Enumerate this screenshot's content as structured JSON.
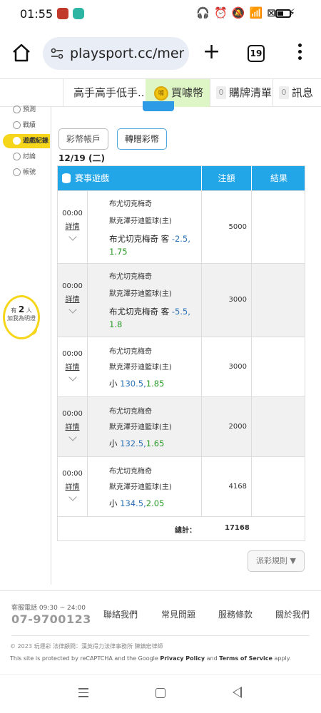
{
  "status_bar": {
    "time": "01:55",
    "icons": [
      "headphones-icon",
      "alarm-icon",
      "mute-icon",
      "wifi-icon",
      "sim-icon",
      "battery-icon",
      "charging-icon"
    ]
  },
  "browser": {
    "url": "playsport.cc/men",
    "tab_count": "19"
  },
  "site_nav": {
    "title": "高手高手低手...",
    "coin_label": "買噱幣",
    "coin_icon_text": "噱",
    "cart_count": "0",
    "cart_label": "購牌清單",
    "msg_count": "0",
    "msg_label": "訊息"
  },
  "sidebar": {
    "items": [
      {
        "label": "預測"
      },
      {
        "label": "戰績"
      },
      {
        "label": "遊戲紀錄"
      },
      {
        "label": "討論"
      },
      {
        "label": "帳號"
      }
    ],
    "active_index": 2,
    "bulb": {
      "prefix": "有",
      "count": "2",
      "suffix": "人",
      "line2": "加我為明燈"
    }
  },
  "content": {
    "tabs": [
      {
        "label": "彩幣帳戶"
      },
      {
        "label": "轉贈彩幣"
      }
    ],
    "date": "12/19 (二)",
    "table": {
      "headers": {
        "game": "賽事遊戲",
        "amount": "注額",
        "result": "結果"
      },
      "rows": [
        {
          "time": "00:00",
          "detail": "詳情",
          "team1": "布尤切克梅奇",
          "team2": "默克澤芬迪籃球(主)",
          "bet_prefix": "布尤切克梅奇 客",
          "line": "-2.5",
          "sep": ",",
          "odds": "1.75",
          "amount": "5000"
        },
        {
          "time": "00:00",
          "detail": "詳情",
          "team1": "布尤切克梅奇",
          "team2": "默克澤芬迪籃球(主)",
          "bet_prefix": "布尤切克梅奇 客",
          "line": "-5.5",
          "sep": ",",
          "odds": "1.8",
          "amount": "3000"
        },
        {
          "time": "00:00",
          "detail": "詳情",
          "team1": "布尤切克梅奇",
          "team2": "默克澤芬迪籃球(主)",
          "bet_prefix": "小",
          "line": "130.5",
          "sep": ",",
          "odds": "1.85",
          "amount": "3000"
        },
        {
          "time": "00:00",
          "detail": "詳情",
          "team1": "布尤切克梅奇",
          "team2": "默克澤芬迪籃球(主)",
          "bet_prefix": "小",
          "line": "132.5",
          "sep": ",",
          "odds": "1.65",
          "amount": "2000"
        },
        {
          "time": "00:00",
          "detail": "詳情",
          "team1": "布尤切克梅奇",
          "team2": "默克澤芬迪籃球(主)",
          "bet_prefix": "小",
          "line": "134.5",
          "sep": ",",
          "odds": "2.05",
          "amount": "4168"
        }
      ],
      "total_label": "總計：",
      "total_value": "17168"
    },
    "rules_button": "派彩規則 ▼"
  },
  "footer": {
    "phone_label": "客服電話 09:30 ~ 24:00",
    "phone": "07-9700123",
    "links": [
      "聯絡我們",
      "常見問題",
      "服務條款",
      "關於我們"
    ],
    "copyright": "© 2023 玩運彩 法律顧問：漢英得力法律事務所 陳鎮宏律師",
    "recaptcha_pre": "This site is protected by reCAPTCHA and the Google ",
    "privacy": "Privacy Policy",
    "and": " and ",
    "terms": "Terms of Service",
    "apply": " apply."
  },
  "colors": {
    "accent": "#22a6e8",
    "active_side": "#f6d61a",
    "coin_bg": "#def5c5",
    "value_blue": "#2d73b6",
    "value_green": "#2a9a2a"
  }
}
